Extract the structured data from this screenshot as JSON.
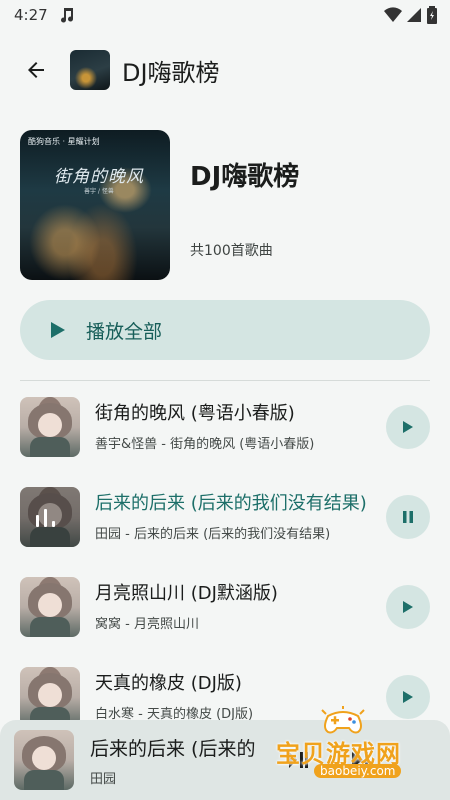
{
  "status_bar": {
    "time": "4:27",
    "icons": [
      "music-note-icon",
      "wifi-icon",
      "signal-icon",
      "battery-icon"
    ]
  },
  "app_bar": {
    "title": "DJ嗨歌榜",
    "back_icon": "arrow-left-icon"
  },
  "header": {
    "title": "DJ嗨歌榜",
    "count_text": "共100首歌曲",
    "cover": {
      "brand": "酷狗音乐 · 星耀计划",
      "script_title": "街角的晚风",
      "artist": "善宇 / 怪兽"
    }
  },
  "play_all": {
    "label": "播放全部",
    "icon": "play-icon"
  },
  "songs": [
    {
      "title": "街角的晚风 (粤语小春版)",
      "subtitle": "善宇&怪兽 - 街角的晚风 (粤语小春版)",
      "action": "play-icon",
      "active": false
    },
    {
      "title": "后来的后来 (后来的我们没有结果)",
      "subtitle": "田园 - 后来的后来 (后来的我们没有结果)",
      "action": "pause-icon",
      "active": true
    },
    {
      "title": "月亮照山川 (DJ默涵版)",
      "subtitle": "窝窝 - 月亮照山川",
      "action": "play-icon",
      "active": false
    },
    {
      "title": "天真的橡皮 (DJ版)",
      "subtitle": "白水寒 - 天真的橡皮 (DJ版)",
      "action": "play-icon",
      "active": false
    }
  ],
  "mini_player": {
    "title": "后来的后来 (后来的",
    "artist": "田园",
    "controls": [
      "play-pause-icon",
      "next-icon"
    ]
  },
  "watermark": {
    "text": "宝贝游戏网",
    "url": "baobeiy.com"
  },
  "colors": {
    "accent": "#1d6f69",
    "accent_bg": "#d4e5e2",
    "background": "#f4f6f5",
    "watermark": "#f0a21c"
  }
}
